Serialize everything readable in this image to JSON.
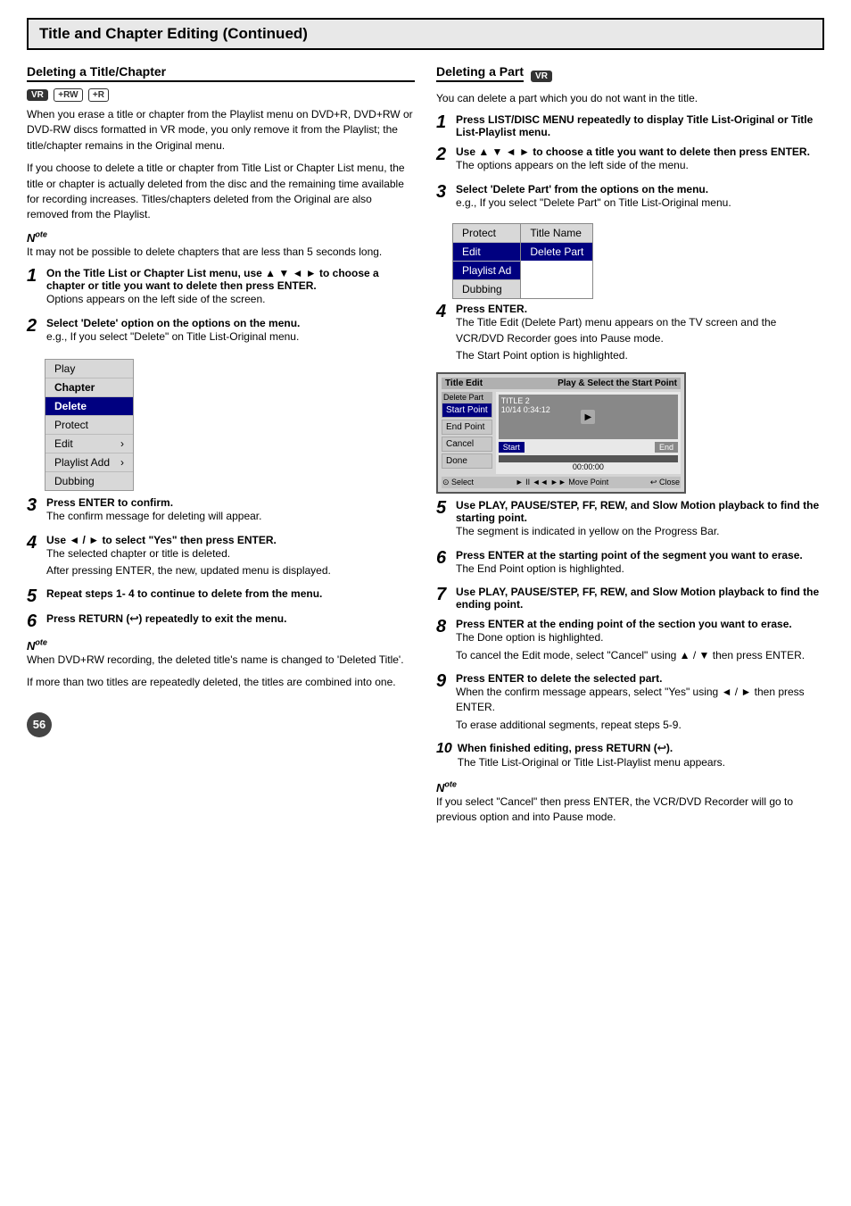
{
  "page": {
    "title": "Title and Chapter Editing (Continued)"
  },
  "left": {
    "section_title": "Deleting a Title/Chapter",
    "badges": [
      "VR",
      "+RW",
      "+R"
    ],
    "intro_para1": "When you erase a title or chapter from the Playlist menu on DVD+R, DVD+RW or DVD-RW discs formatted in VR mode, you only remove it from the Playlist; the title/chapter remains in the Original menu.",
    "intro_para2": "If you choose to delete a title or chapter from Title List or Chapter List menu, the title or chapter is actually deleted from the disc and the remaining time available for recording increases. Titles/chapters deleted from the Original are also removed from the Playlist.",
    "note_label": "ote",
    "note_text": "It may not be possible to delete chapters that are less than 5 seconds long.",
    "step1_num": "1",
    "step1_text": "On the Title List or Chapter List menu, use ▲ ▼ ◄ ► to choose a chapter or title you want to delete then press ENTER.",
    "step1_sub": "Options appears on the left side of the screen.",
    "step2_num": "2",
    "step2_text": "Select 'Delete' option on the options on the menu.",
    "step2_sub": "e.g., If you select \"Delete\" on Title List-Original menu.",
    "menu_items": [
      {
        "label": "Play",
        "bold": false,
        "highlighted": false
      },
      {
        "label": "Chapter",
        "bold": true,
        "highlighted": false
      },
      {
        "label": "Delete",
        "bold": true,
        "highlighted": false
      },
      {
        "label": "Protect",
        "bold": false,
        "highlighted": false
      },
      {
        "label": "Edit",
        "bold": false,
        "highlighted": false,
        "arrow": "›"
      },
      {
        "label": "Playlist Add",
        "bold": false,
        "highlighted": false,
        "arrow": "›"
      },
      {
        "label": "Dubbing",
        "bold": false,
        "highlighted": false
      }
    ],
    "step3_num": "3",
    "step3_text": "Press ENTER to confirm.",
    "step3_sub": "The confirm message for deleting will appear.",
    "step4_num": "4",
    "step4_text": "Use ◄ / ► to select \"Yes\" then press ENTER.",
    "step4_sub1": "The selected chapter or title is deleted.",
    "step4_sub2": "After pressing ENTER, the new, updated menu is displayed.",
    "step5_num": "5",
    "step5_text": "Repeat steps 1- 4 to continue to delete from the menu.",
    "step6_num": "6",
    "step6_text": "Press RETURN (",
    "step6_text2": ") repeatedly to exit the menu.",
    "note2_label": "ote",
    "note2_line1": "When DVD+RW recording, the deleted title's name is changed to 'Deleted Title'.",
    "note2_line2": "If more than two titles are repeatedly deleted, the titles are combined into one.",
    "page_num": "56"
  },
  "right": {
    "section_title": "Deleting a Part",
    "badge": "VR",
    "intro": "You can delete a part which you do not want in the title.",
    "step1_num": "1",
    "step1_text": "Press LIST/DISC MENU repeatedly to display Title List-Original or Title List-Playlist menu.",
    "step2_num": "2",
    "step2_text": "Use ▲ ▼ ◄ ► to choose a title you want to delete then press ENTER.",
    "step2_sub": "The options appears on the left side of the menu.",
    "step3_num": "3",
    "step3_text": "Select 'Delete Part' from the options on the menu.",
    "step3_sub": "e.g., If you select \"Delete Part\" on Title List-Original menu.",
    "right_menu_col1": [
      "Protect",
      "Edit",
      "Playlist Ad",
      "Dubbing"
    ],
    "right_menu_col2_title": "Title Name",
    "right_menu_col2_delete": "Delete Part",
    "step4_num": "4",
    "step4_text": "Press ENTER.",
    "step4_sub1": "The Title Edit (Delete Part) menu appears on the TV screen and the VCR/DVD Recorder goes into Pause mode.",
    "step4_sub2": "The Start Point option is highlighted.",
    "te_header_left": "Title Edit",
    "te_header_right": "Play & Select the Start Point",
    "te_delete_part": "Delete Part",
    "te_title": "TITLE 2",
    "te_date": "10/14",
    "te_time": "0:34:12",
    "te_sidebar_items": [
      "Start Point",
      "End Point",
      "Cancel",
      "Done"
    ],
    "te_start_btn": "Start",
    "te_end_btn": "End",
    "te_timecode": "00:00:00",
    "te_footer_items": [
      "⊙ Select",
      "► II ◄◄ ►► Move Point",
      "↩ Close"
    ],
    "step5_num": "5",
    "step5_text": "Use PLAY, PAUSE/STEP, FF, REW, and Slow Motion playback to find the starting point.",
    "step5_sub": "The segment is indicated in yellow on the Progress Bar.",
    "step6_num": "6",
    "step6_text": "Press ENTER at the starting point of the segment you want to erase.",
    "step6_sub": "The End Point option is highlighted.",
    "step7_num": "7",
    "step7_text": "Use PLAY, PAUSE/STEP, FF, REW, and Slow Motion playback to find the ending point.",
    "step8_num": "8",
    "step8_text": "Press ENTER at the ending point of the section you want to erase.",
    "step8_sub1": "The Done option is highlighted.",
    "step8_sub2": "To cancel the Edit mode, select \"Cancel\" using ▲ / ▼ then press ENTER.",
    "step9_num": "9",
    "step9_text": "Press ENTER to delete the selected part.",
    "step9_sub1": "When the confirm message appears, select \"Yes\" using ◄ / ► then press ENTER.",
    "step9_sub2": "To erase additional segments, repeat steps 5-9.",
    "step10_num": "10",
    "step10_text": "When finished editing, press RETURN (",
    "step10_text2": ").",
    "step10_sub": "The Title List-Original or Title List-Playlist menu appears.",
    "note_label": "ote",
    "note_text": "If you select \"Cancel\" then press ENTER, the VCR/DVD Recorder will go to previous option and into Pause mode."
  }
}
